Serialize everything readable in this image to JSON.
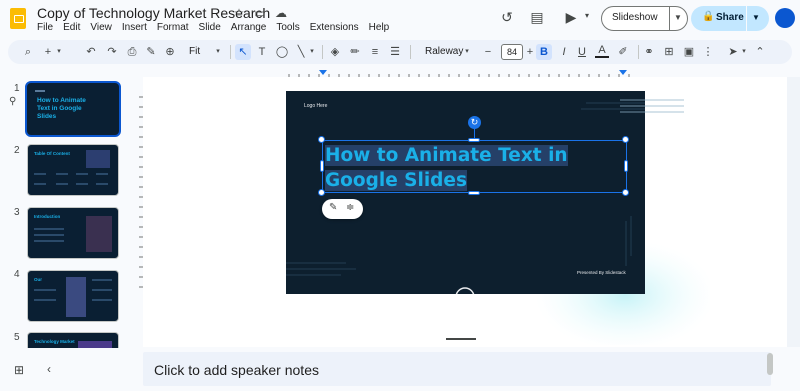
{
  "app": {
    "doc_title": "Copy of Technology Market Research",
    "title_icons": [
      "star-icon",
      "folder-move-icon",
      "cloud-done-icon"
    ],
    "menus": [
      "File",
      "Edit",
      "View",
      "Insert",
      "Format",
      "Slide",
      "Arrange",
      "Tools",
      "Extensions",
      "Help"
    ]
  },
  "header_right": {
    "history_icon": "history-icon",
    "comments_icon": "comments-icon",
    "meet_icon": "video-call-icon",
    "slideshow_label": "Slideshow",
    "share_label": "Share"
  },
  "toolbar": {
    "zoom": "Fit",
    "font_name": "Raleway",
    "font_size": "84",
    "bold": "B",
    "italic": "I",
    "underline": "U",
    "text_color": "A",
    "text_tool": "T"
  },
  "slides": [
    {
      "number": "1",
      "title": "How to Animate Text in Google Slides",
      "selected": true
    },
    {
      "number": "2",
      "title": "Table Of Content"
    },
    {
      "number": "3",
      "title": "Introduction"
    },
    {
      "number": "4",
      "title": "Our"
    },
    {
      "number": "5",
      "title": "Technology Market"
    }
  ],
  "current_slide": {
    "logo_text": "Logo Here",
    "title": "How to Animate Text in Google Slides",
    "presented_by": "Presented By Slidestack"
  },
  "notes": {
    "placeholder": "Click to add speaker notes"
  },
  "colors": {
    "accent": "#0b57d0",
    "share_bg": "#c2e7ff",
    "slide_bg": "#0d1f2e",
    "title_text": "#1ab0e8",
    "selection": "#1a73e8"
  }
}
